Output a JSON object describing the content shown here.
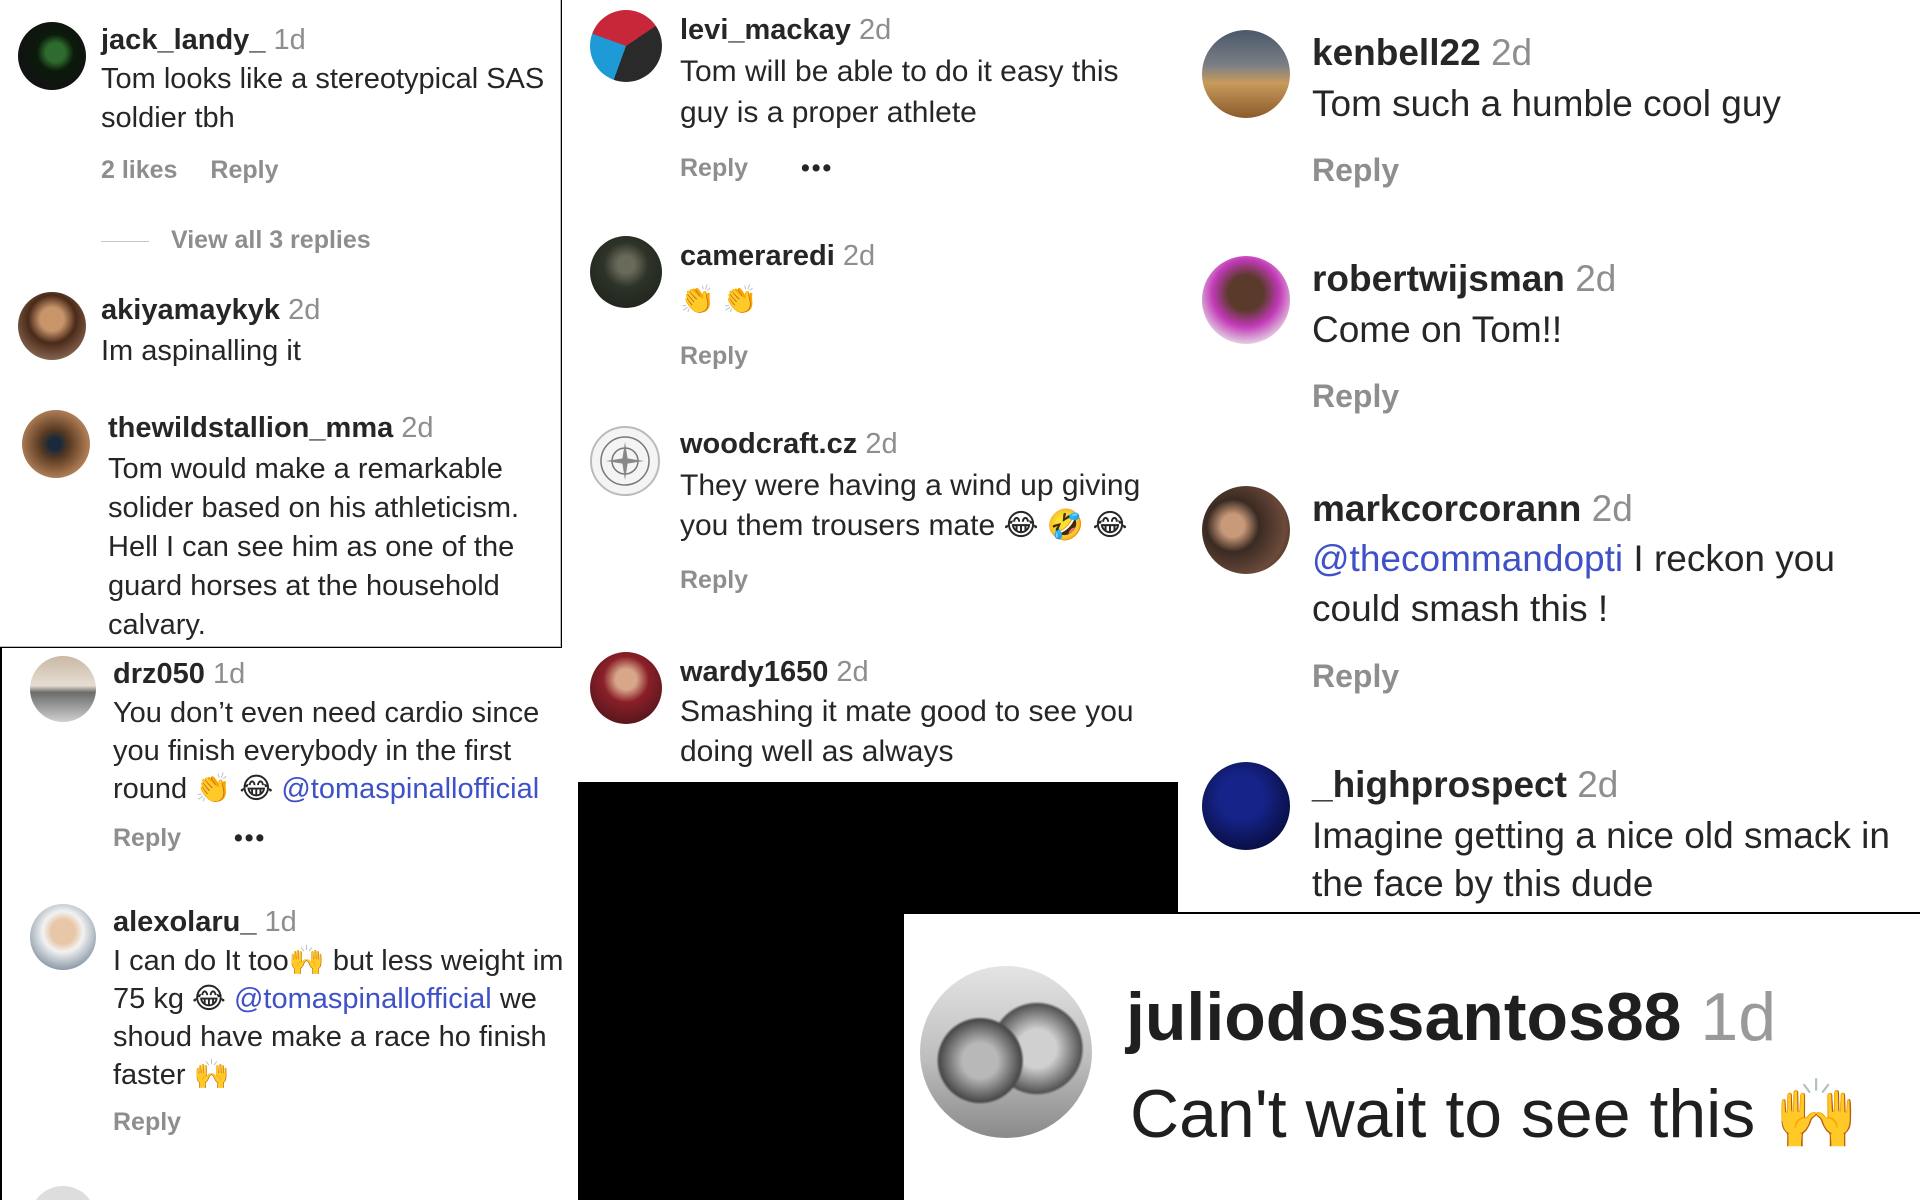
{
  "panels": {
    "p1": {
      "c1": {
        "user": "jack_landy_",
        "time": "1d",
        "text": "Tom looks like a stereotypical SAS soldier tbh",
        "likes": "2 likes",
        "reply": "Reply",
        "view_replies": "View all 3 replies"
      },
      "c2": {
        "user": "akiyamaykyk",
        "time": "2d",
        "text": "Im aspinalling it"
      },
      "c3": {
        "user": "thewildstallion_mma",
        "time": "2d",
        "text": "Tom would make a remarkable solider based on his athleticism. Hell I can see him as one of the guard horses at the household calvary."
      }
    },
    "p2": {
      "c1": {
        "user": "levi_mackay",
        "time": "2d",
        "text": "Tom will be able to do it easy this guy is a proper athlete",
        "reply": "Reply",
        "more": "•••"
      },
      "c2": {
        "user": "cameraredi",
        "time": "2d",
        "text": "👏 👏",
        "reply": "Reply"
      },
      "c3": {
        "user": "woodcraft.cz",
        "time": "2d",
        "text": "They were having a wind up giving you them trousers mate 😂 🤣 😂",
        "reply": "Reply"
      },
      "c4": {
        "user": "wardy1650",
        "time": "2d",
        "text": "Smashing it mate good to see you doing well as always"
      }
    },
    "p3": {
      "c1": {
        "user": "kenbell22",
        "time": "2d",
        "text": "Tom such a humble cool guy",
        "reply": "Reply"
      },
      "c2": {
        "user": "robertwijsman",
        "time": "2d",
        "text": "Come on Tom!!",
        "reply": "Reply"
      },
      "c3": {
        "user": "markcorcorann",
        "time": "2d",
        "mention": "@thecommandopti",
        "text": " I reckon you could smash this !",
        "reply": "Reply"
      },
      "c4": {
        "user": "_highprospect",
        "time": "2d",
        "text": "Imagine getting a nice old smack in the face by this dude"
      }
    },
    "p4": {
      "c1": {
        "user": "drz050",
        "time": "1d",
        "text": "You don’t even need cardio since you finish everybody in the first round 👏 😂 ",
        "mention": "@tomaspinallofficial",
        "reply": "Reply",
        "more": "•••"
      },
      "c2": {
        "user": "alexolaru_",
        "time": "1d",
        "text_a": "I can do It too🙌 but less weight im 75 kg 😂 ",
        "mention": "@tomaspinallofficial",
        "text_b": " we shoud have make a race ho finish faster 🙌",
        "reply": "Reply"
      }
    },
    "p5": {
      "c1": {
        "user": "juliodossantos88",
        "time": "1d",
        "text": "Can't wait to see this 🙌"
      }
    }
  },
  "colors": {
    "username": "#262626",
    "secondary": "#8e8e8e",
    "mention": "#3f51c7",
    "background": "#ffffff",
    "separator": "#000000"
  },
  "icons": [
    "avatar-jack-landy",
    "avatar-akiyamaykyk",
    "avatar-thewildstallion",
    "avatar-levi-mackay",
    "avatar-cameraredi",
    "avatar-woodcraft",
    "avatar-wardy1650",
    "avatar-kenbell22",
    "avatar-robertwijsman",
    "avatar-markcorcorann",
    "avatar-highprospect",
    "avatar-drz050",
    "avatar-alexolaru",
    "avatar-juliodossantos88"
  ]
}
